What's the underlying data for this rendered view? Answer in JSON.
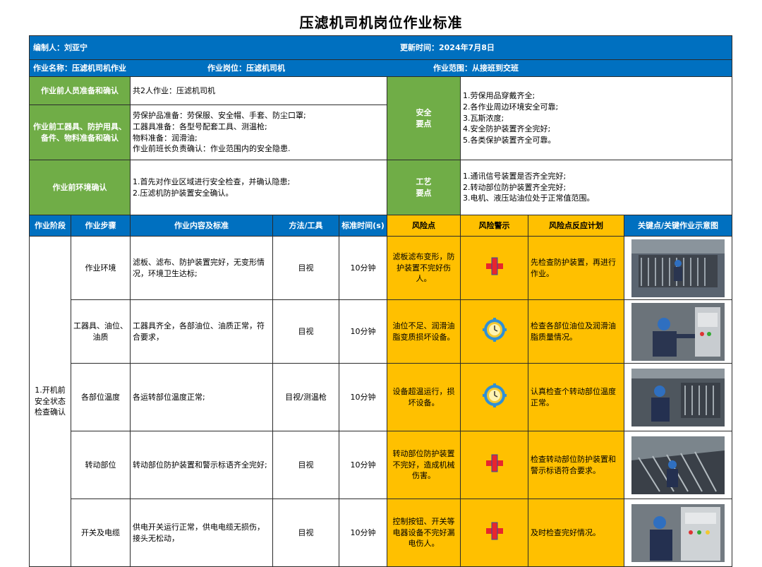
{
  "title": "压滤机司机岗位作业标准",
  "header": {
    "editor": "编制人：刘亚宁",
    "updated": "更新时间：2024年7月8日",
    "job_name": "作业名称：压滤机司机作业",
    "job_post": "作业岗位：压滤机司机",
    "job_scope": "作业范围：从接班到交班"
  },
  "prep": {
    "personnel_label": "作业前人员准备和确认",
    "personnel_text": "共2人作业：压滤机司机",
    "tools_label": "作业前工器具、防护用具、备件、物料准备和确认",
    "tools_lines": [
      "劳保护品准备：劳保服、安全帽、手套、防尘口罩;",
      "工器具准备：各型号配套工具、测温枪;",
      "物料准备：润滑油;",
      "作业前班长负责确认：作业范围内的安全隐患."
    ],
    "env_label": "作业前环境确认",
    "env_lines": [
      "1.首先对作业区域进行安全检查，并确认隐患;",
      "2.压滤机防护装置安全确认。"
    ],
    "safety_label_1": "安全",
    "safety_label_2": "要点",
    "safety_lines": [
      "1.劳保用品穿戴齐全;",
      "2.各作业周边环境安全可靠;",
      "3.瓦斯浓度;",
      "4.安全防护装置齐全完好;",
      "5.各类保护装置齐全可靠。"
    ],
    "process_label_1": "工艺",
    "process_label_2": "要点",
    "process_lines": [
      "1.通讯信号装置是否齐全完好;",
      "2.转动部位防护装置齐全完好;",
      "3.电机、液压站油位处于正常值范围。"
    ]
  },
  "columns": {
    "stage": "作业阶段",
    "step": "作业步骤",
    "content": "作业内容及标准",
    "method": "方法/工具",
    "time": "标准时间(s)",
    "risk": "风险点",
    "warning": "风险警示",
    "plan": "风险点反应计划",
    "diagram": "关键点/关键作业示意图"
  },
  "stage_label": "1.开机前安全状态检查确认",
  "rows": [
    {
      "step": "作业环境",
      "content": "滤板、滤布、防护装置完好，无变形情况，环境卫生达标;",
      "method": "目视",
      "time": "10分钟",
      "risk": "滤板滤布变形，防护装置不完好伤人。",
      "warning_icon": "red-cross-icon",
      "plan": "先检查防护装置，再进行作业。"
    },
    {
      "step": "工器具、油位、油质",
      "content": "工器具齐全，各部油位、油质正常，符合要求，",
      "method": "目视",
      "time": "10分钟",
      "risk": "油位不足、润滑油脂变质损坏设备。",
      "warning_icon": "gear-clock-icon",
      "plan": "检查各部位油位及润滑油脂质量情况。"
    },
    {
      "step": "各部位温度",
      "content": "各运转部位温度正常;",
      "method": "目视/测温枪",
      "time": "10分钟",
      "risk": "设备超温运行，损坏设备。",
      "warning_icon": "gear-clock-icon",
      "plan": "认真检查个转动部位温度正常。"
    },
    {
      "step": "转动部位",
      "content": "转动部位防护装置和警示标语齐全完好;",
      "method": "目视",
      "time": "10分钟",
      "risk": "转动部位防护装置不完好，造成机械伤害。",
      "warning_icon": "red-cross-icon",
      "plan": "检查转动部位防护装置和警示标语符合要求。"
    },
    {
      "step": "开关及电缆",
      "content": "供电开关运行正常，供电电缆无损伤，接头无松动，",
      "method": "目视",
      "time": "10分钟",
      "risk": "控制按钮、开关等电器设备不完好漏电伤人。",
      "warning_icon": "red-cross-icon",
      "plan": "及时检查完好情况。"
    }
  ],
  "colors": {
    "blue": "#0070c0",
    "green": "#70ad47",
    "yellow": "#ffc000",
    "red": "#e8262d"
  }
}
